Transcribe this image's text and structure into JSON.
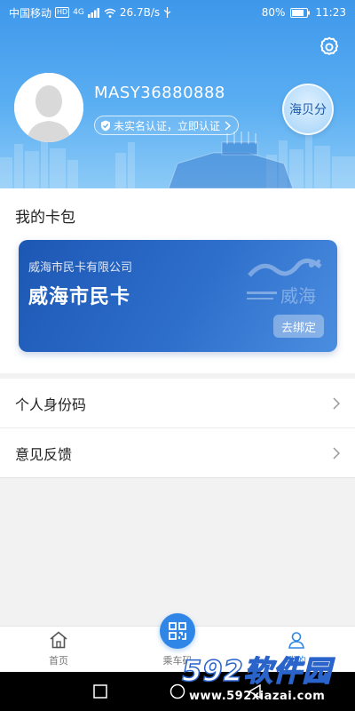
{
  "status_bar": {
    "carrier": "中国移动",
    "hd_badge": "HD",
    "network": "4G",
    "speed": "26.7B/s",
    "battery_percent": "80%",
    "time": "11:23"
  },
  "profile": {
    "username": "MASY36880888",
    "verify_text": "未实名认证，立即认证",
    "points_label": "海贝分"
  },
  "card_wallet": {
    "title": "我的卡包",
    "card": {
      "company": "威海市民卡有限公司",
      "name": "威海市民卡",
      "logo_text": "威海",
      "unbind_label": "去绑定"
    }
  },
  "menu": [
    {
      "label": "个人身份码"
    },
    {
      "label": "意见反馈"
    }
  ],
  "bottom_nav": {
    "home_label": "首页",
    "ride_label": "乘车码",
    "mine_label": "我的"
  },
  "watermark": {
    "main": "592软件园",
    "sub": "www.592xiazai.com"
  },
  "colors": {
    "header_blue": "#3e97ea",
    "card_blue": "#1d57b4",
    "accent_blue": "#2f86e6"
  }
}
